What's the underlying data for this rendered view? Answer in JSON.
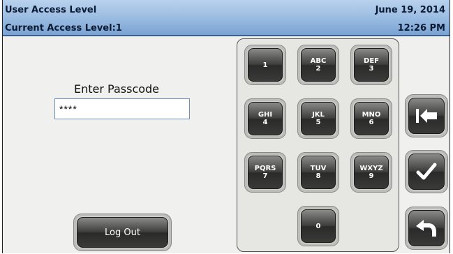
{
  "header": {
    "title": "User Access Level",
    "access_level": "Current Access Level:1",
    "date": "June 19, 2014",
    "time": "12:26 PM"
  },
  "passcode": {
    "label": "Enter Passcode",
    "value": "****"
  },
  "keypad": {
    "keys": [
      {
        "letters": "",
        "digit": "1"
      },
      {
        "letters": "ABC",
        "digit": "2"
      },
      {
        "letters": "DEF",
        "digit": "3"
      },
      {
        "letters": "GHI",
        "digit": "4"
      },
      {
        "letters": "JKL",
        "digit": "5"
      },
      {
        "letters": "MNO",
        "digit": "6"
      },
      {
        "letters": "PQRS",
        "digit": "7"
      },
      {
        "letters": "TUV",
        "digit": "8"
      },
      {
        "letters": "WXYZ",
        "digit": "9"
      },
      {
        "letters": "",
        "digit": "0"
      }
    ]
  },
  "actions": {
    "logout_label": "Log Out",
    "backspace_icon": "backspace-arrow-icon",
    "confirm_icon": "checkmark-icon",
    "back_icon": "return-arrow-icon"
  },
  "colors": {
    "header_top": "#b9d2ee",
    "header_bottom": "#7aa3d3",
    "key_face": "#3e3e3d"
  }
}
